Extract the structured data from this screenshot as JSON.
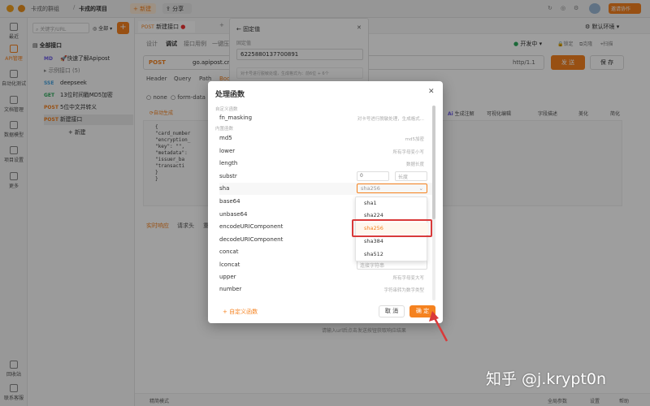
{
  "topbar": {
    "team": "卡戎的群组",
    "project": "卡戎的项目",
    "new_btn": "新建",
    "share": "分享",
    "invite": "邀请协作"
  },
  "leftnav": [
    "最近",
    "API管理",
    "自动化测试",
    "文档管理",
    "数据模型",
    "项目设置",
    "更多",
    "回收站",
    "联系客服"
  ],
  "tree": {
    "search_placeholder": "关键字/URL",
    "filter": "全部",
    "root": "全部接口",
    "items": [
      {
        "method": "MD",
        "name": "🚀快速了解Apipost"
      },
      {
        "method": "",
        "name": "示例接口",
        "count": "(5)"
      },
      {
        "method": "SSE",
        "name": "deepseek"
      },
      {
        "method": "GET",
        "name": "13位时间戳MD5加密"
      },
      {
        "method": "POST",
        "name": "5位中文并转义"
      },
      {
        "method": "POST",
        "name": "新建接口"
      }
    ],
    "new_label": "新建"
  },
  "tab": {
    "method": "POST",
    "name": "新建接口"
  },
  "main": {
    "subtabs": [
      "设计",
      "调试",
      "接口用例",
      "一键压"
    ],
    "env_running": "开发中",
    "env_default": "默认环境",
    "lock": "锁定",
    "share": "分享",
    "clone": "克隆",
    "scan": "扫描",
    "method": "POST",
    "url": "go.apipost.cn",
    "http": "http/1.1",
    "send": "发 送",
    "save": "保 存",
    "req_tabs": [
      "Header",
      "Query",
      "Path",
      "Bod"
    ],
    "body_opts": [
      "none",
      "form-data"
    ],
    "auto_gen": "自动生成",
    "ai_tools": [
      "生成注解",
      "可视化编辑",
      "字段描述",
      "美化",
      "简化"
    ],
    "code": [
      "{",
      "  \"card_number",
      "  \"encryption_",
      "  \"key\": \"\",",
      "  \"metadata\":",
      "    \"issuer_ba",
      "    \"transacti",
      "  }",
      "}"
    ],
    "resp_tabs": [
      "实时响应",
      "请求头",
      "重"
    ],
    "resp_hint": "请输入url后点击发送按钮获取响应结果",
    "bottom": [
      "精简模式",
      "全局参数",
      "设置",
      "帮助"
    ]
  },
  "fixed_panel": {
    "back": "固定值",
    "label": "固定值",
    "value": "6225880137700891",
    "hint": "对卡号进行脱敏处理，生成格式为：前6位 + 6个"
  },
  "dialog": {
    "title": "处理函数",
    "custom_label": "自定义函数",
    "builtin_label": "内置函数",
    "rows": [
      {
        "name": "fn_masking",
        "hint": "对卡号进行脱敏处理，生成格式..."
      },
      {
        "name": "md5",
        "hint": "md5加密"
      },
      {
        "name": "lower",
        "hint": "所有字母变小写"
      },
      {
        "name": "length",
        "hint": "数据长度"
      },
      {
        "name": "substr",
        "in1": "0",
        "in2": "长度"
      },
      {
        "name": "sha",
        "select": "sha256"
      },
      {
        "name": "base64"
      },
      {
        "name": "unbase64"
      },
      {
        "name": "encodeURIComponent"
      },
      {
        "name": "decodeURIComponent"
      },
      {
        "name": "concat"
      },
      {
        "name": "lconcat",
        "in1": "连接字符串"
      },
      {
        "name": "upper",
        "hint": "所有字母变大写"
      },
      {
        "name": "number",
        "hint": "字符串转为数字类型"
      }
    ],
    "options": [
      "sha1",
      "sha224",
      "sha256",
      "sha384",
      "sha512"
    ],
    "selected": "sha256",
    "footer_custom": "自定义函数",
    "cancel": "取 消",
    "ok": "确 定"
  },
  "watermark": "知乎 @j.krypt0n",
  "colors": {
    "accent": "#f5821f",
    "highlight": "#d93a3a"
  }
}
